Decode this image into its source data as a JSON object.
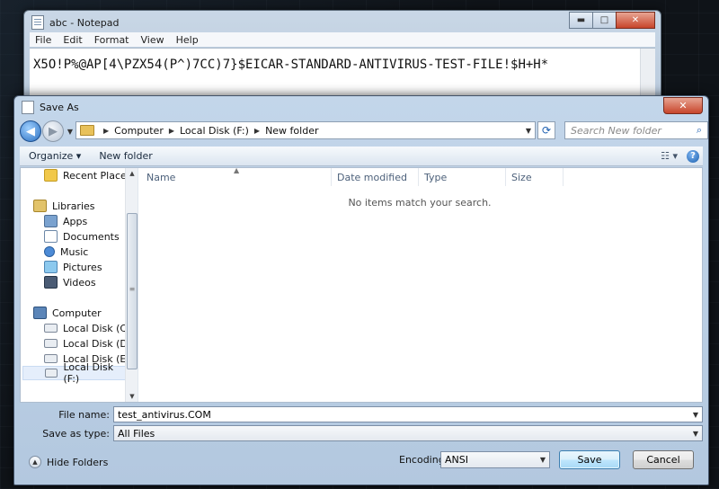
{
  "notepad": {
    "title": "abc - Notepad",
    "menu": [
      "File",
      "Edit",
      "Format",
      "View",
      "Help"
    ],
    "content": "X5O!P%@AP[4\\PZX54(P^)7CC)7}$EICAR-STANDARD-ANTIVIRUS-TEST-FILE!$H+H*",
    "controls": {
      "minimize": "▬",
      "maximize": "□",
      "close": "✕"
    }
  },
  "dialog": {
    "title": "Save As",
    "close_label": "✕",
    "breadcrumb": [
      "Computer",
      "Local Disk (F:)",
      "New folder"
    ],
    "search_placeholder": "Search New folder",
    "toolbar": {
      "organize": "Organize ▾",
      "new_folder": "New folder"
    },
    "nav_pane": {
      "recent": "Recent Places",
      "libraries": "Libraries",
      "library_items": [
        "Apps",
        "Documents",
        "Music",
        "Pictures",
        "Videos"
      ],
      "computer": "Computer",
      "drives": [
        "Local Disk (C:)",
        "Local Disk (D:)",
        "Local Disk (E:)",
        "Local Disk (F:)"
      ],
      "selected_drive": "Local Disk (F:)"
    },
    "columns": [
      "Name",
      "Date modified",
      "Type",
      "Size"
    ],
    "empty_message": "No items match your search.",
    "file_name_label": "File name:",
    "file_name_value": "test_antivirus.COM",
    "save_type_label": "Save as type:",
    "save_type_value": "All Files",
    "hide_folders": "Hide Folders",
    "encoding_label": "Encoding:",
    "encoding_value": "ANSI",
    "save_button": "Save",
    "cancel_button": "Cancel"
  }
}
